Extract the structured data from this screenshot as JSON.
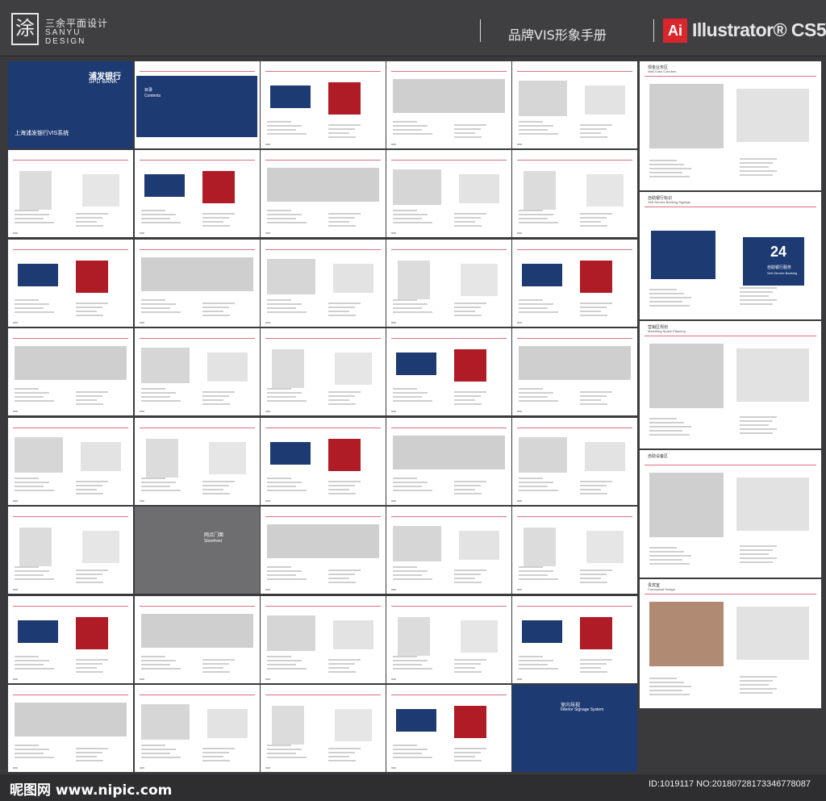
{
  "header": {
    "logo_glyph": "涂",
    "brand_cn": "三余平面设计",
    "brand_en_1": "SANYU",
    "brand_en_2": "DESIGN",
    "manual_title": "品牌VIS形象手册",
    "ai_badge": "Ai",
    "software": "Illustrator® CS5"
  },
  "pages": {
    "cover_logo": "浦发银行",
    "cover_logo_en": "SPD BANK",
    "cover_title": "上海浦发银行VIS系统",
    "contents_cn": "目录",
    "contents_en": "Contents",
    "storefront_cn": "网点门面",
    "storefront_en": "Storefront",
    "interior_cn": "室内导视",
    "interior_en": "Interior Signage System",
    "badge_24": "24",
    "self_service_cn": "自助银行服务",
    "self_service_en": "Self-Service Banking",
    "wall_title": "现金业务区",
    "wall_sub": "Wall Cash Counters",
    "signage_title": "自助银行标识",
    "signage_sub": "Self-Service Banking Signage",
    "marketing_title": "营销区规划",
    "marketing_sub": "Marketing Space Planning",
    "atm_title": "自助设备区",
    "vip_title": "贵宾室",
    "vip_sub": "Conceptual Design"
  },
  "colors": {
    "brand_navy": "#1d3a73",
    "brand_red": "#c8102e"
  },
  "footer": {
    "site": "昵图网 www.nipic.com",
    "id_text": "ID:1019117 NO:20180728173346778087"
  }
}
